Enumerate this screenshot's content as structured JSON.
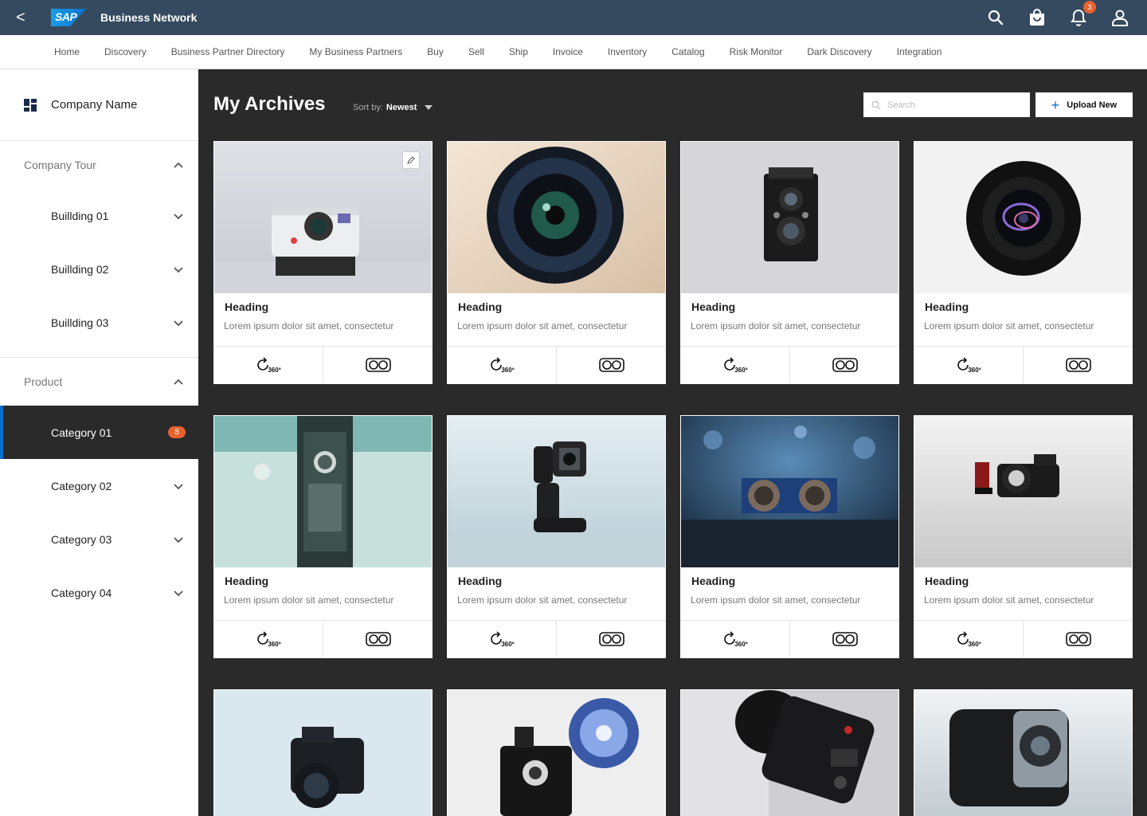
{
  "app": {
    "back_label": "<",
    "logo_text": "SAP",
    "title": "Business Network",
    "notification_count": "3"
  },
  "nav": [
    "Home",
    "Discovery",
    "Business Partner Directory",
    "My Business Partners",
    "Buy",
    "Sell",
    "Ship",
    "Invoice",
    "Inventory",
    "Catalog",
    "Risk Monitor",
    "Dark Discovery",
    "Integration"
  ],
  "sidebar": {
    "company_name": "Company Name",
    "tour": {
      "title": "Company Tour",
      "items": [
        "Buillding 01",
        "Buillding 02",
        "Buillding 03"
      ]
    },
    "product": {
      "title": "Product",
      "items": [
        {
          "label": "Category 01",
          "badge": "8",
          "active": true
        },
        {
          "label": "Category 02"
        },
        {
          "label": "Category 03"
        },
        {
          "label": "Category 04"
        }
      ]
    }
  },
  "main": {
    "title": "My Archives",
    "sort_label": "Sort by:",
    "sort_value": "Newest",
    "search_placeholder": "Search",
    "upload_label": "Upload New",
    "view360_label": "360º",
    "cards": [
      {
        "heading": "Heading",
        "desc": "Lorem ipsum dolor sit amet, consectetur",
        "image": "instant-camera"
      },
      {
        "heading": "Heading",
        "desc": "Lorem ipsum dolor sit amet, consectetur",
        "image": "camera-lens"
      },
      {
        "heading": "Heading",
        "desc": "Lorem ipsum dolor sit amet, consectetur",
        "image": "twin-lens-camera"
      },
      {
        "heading": "Heading",
        "desc": "Lorem ipsum dolor sit amet, consectetur",
        "image": "olympus-lens"
      },
      {
        "heading": "Heading",
        "desc": "Lorem ipsum dolor sit amet, consectetur",
        "image": "vintage-device"
      },
      {
        "heading": "Heading",
        "desc": "Lorem ipsum dolor sit amet, consectetur",
        "image": "gimbal-camera"
      },
      {
        "heading": "Heading",
        "desc": "Lorem ipsum dolor sit amet, consectetur",
        "image": "ultrasonic-sensor"
      },
      {
        "heading": "Heading",
        "desc": "Lorem ipsum dolor sit amet, consectetur",
        "image": "compact-camera"
      },
      {
        "image": "mirrorless-camera"
      },
      {
        "image": "flash-camera"
      },
      {
        "image": "studio-flash"
      },
      {
        "image": "action-camera"
      }
    ]
  },
  "colors": {
    "shell": "#354a5f",
    "accent": "#0a6ed1",
    "badge": "#e9622f",
    "main_bg": "#2a2a2a"
  }
}
